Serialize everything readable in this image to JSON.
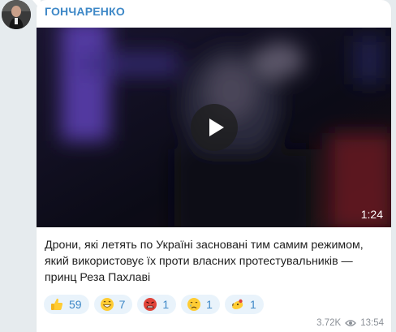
{
  "channel": {
    "name": "ГОНЧАРЕНКО"
  },
  "video": {
    "duration": "1:24"
  },
  "message": {
    "text": "Дрони, які летять по Україні засновані тим самим режимом, який використовує їх проти власних протестувальників — принц Реза Пахлаві"
  },
  "reactions": [
    {
      "emoji": "thumbs-up-icon",
      "count": "59"
    },
    {
      "emoji": "grinning-face-icon",
      "count": "7"
    },
    {
      "emoji": "angry-face-icon",
      "count": "1"
    },
    {
      "emoji": "crying-face-icon",
      "count": "1"
    },
    {
      "emoji": "clown-face-icon",
      "count": "1"
    }
  ],
  "meta": {
    "views": "3.72K",
    "time": "13:54"
  },
  "colors": {
    "accent": "#3e88c7",
    "background": "#e6ebee",
    "reaction_bg": "#e9f3fb"
  }
}
